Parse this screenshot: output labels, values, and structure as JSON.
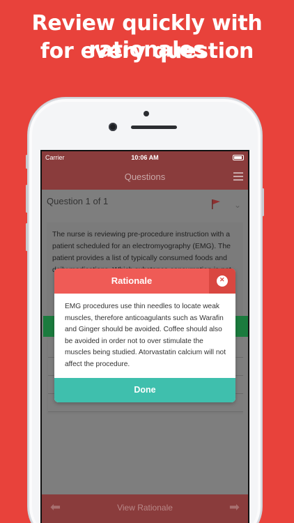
{
  "headline": {
    "line1": "Review quickly with rationales",
    "line2": "for every question"
  },
  "status_bar": {
    "carrier": "Carrier",
    "time": "10:06 AM"
  },
  "nav": {
    "title": "Questions",
    "menu_icon": "hamburger-icon"
  },
  "question": {
    "counter": "Question 1 of 1",
    "flag_icon": "flag-icon",
    "text": "The nurse is reviewing pre-procedure instruction with a patient scheduled for an electromyography (EMG). The patient provides a list of typically consumed foods and daily medications. Which substance consumption is not"
  },
  "modal": {
    "title": "Rationale",
    "body": "EMG procedures use thin needles to locate weak muscles, therefore anticoagulants such as Warafin and Ginger should be avoided. Coffee should also be avoided in order not to over stimulate the muscles being studied. Atorvastatin calcium will not affect the procedure.",
    "done_label": "Done",
    "close_icon": "close-icon"
  },
  "bottom_bar": {
    "label": "View Rationale",
    "prev_icon": "arrow-left-icon",
    "next_icon": "arrow-right-icon"
  },
  "colors": {
    "background": "#e8423b",
    "header": "#ef5b56",
    "done": "#3fbfad"
  }
}
